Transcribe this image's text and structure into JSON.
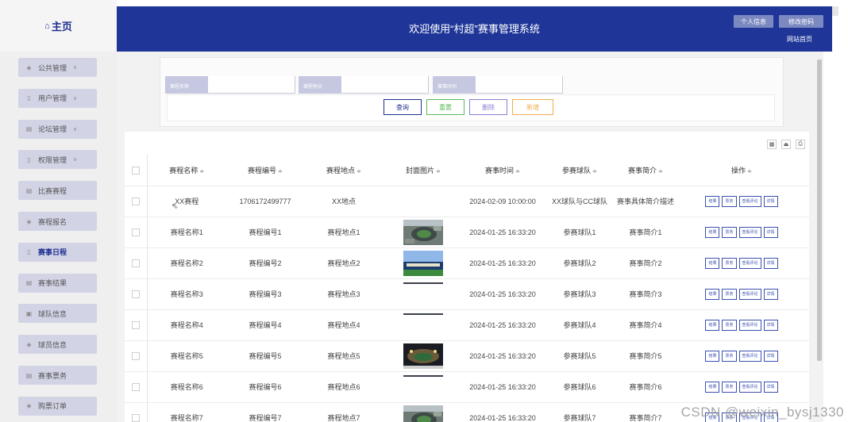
{
  "home": {
    "icon": "home-icon",
    "label": "主页"
  },
  "sidebar": {
    "items": [
      {
        "label": "公共管理",
        "icon": "layers-icon",
        "glyph": "◈",
        "chevron": true
      },
      {
        "label": "用户管理",
        "icon": "doc-icon",
        "glyph": "▯",
        "chevron": true
      },
      {
        "label": "论坛管理",
        "icon": "grid-icon",
        "glyph": "▤",
        "chevron": true
      },
      {
        "label": "权限管理",
        "icon": "doc-icon",
        "glyph": "▯",
        "chevron": true
      },
      {
        "label": "比赛赛程",
        "icon": "grid-icon",
        "glyph": "▤",
        "chevron": false
      },
      {
        "label": "赛程报名",
        "icon": "layers-icon",
        "glyph": "◈",
        "chevron": false
      },
      {
        "label": "赛事日程",
        "icon": "doc-icon",
        "glyph": "▯",
        "chevron": false,
        "active": true
      },
      {
        "label": "赛事结果",
        "icon": "grid-icon",
        "glyph": "▤",
        "chevron": false
      },
      {
        "label": "球队信息",
        "icon": "calendar-icon",
        "glyph": "▣",
        "chevron": false
      },
      {
        "label": "球员信息",
        "icon": "layers-icon",
        "glyph": "◈",
        "chevron": false
      },
      {
        "label": "赛事票务",
        "icon": "grid-icon",
        "glyph": "▤",
        "chevron": false
      },
      {
        "label": "购票订单",
        "icon": "layers-icon",
        "glyph": "◈",
        "chevron": false
      }
    ]
  },
  "header": {
    "title": "欢迎使用“村超”赛事管理系统",
    "profile_label": "个人信息",
    "password_label": "修改密码",
    "site_label": "网站首页"
  },
  "search": {
    "fields": [
      {
        "label": "赛程名称",
        "value": ""
      },
      {
        "label": "赛程地点",
        "value": ""
      },
      {
        "label": "赛事时间",
        "value": ""
      }
    ],
    "actions": {
      "query": "查询",
      "reset": "重置",
      "delete": "删除",
      "add": "新增"
    }
  },
  "table": {
    "tools": [
      {
        "icon": "columns-icon",
        "glyph": "▦"
      },
      {
        "icon": "export-icon",
        "glyph": "⏏"
      },
      {
        "icon": "print-icon",
        "glyph": "⎙"
      }
    ],
    "columns": [
      "赛程名称",
      "赛程编号",
      "赛程地点",
      "封面图片",
      "赛事时间",
      "参赛球队",
      "赛事简介",
      "操作"
    ],
    "sort_glyph": "≑",
    "row_actions": [
      "结果",
      "票务",
      "查看评论",
      "详情"
    ],
    "rows": [
      {
        "name": "XX赛程",
        "code": "1706172499777",
        "place": "XX地点",
        "image": "none",
        "time": "2024-02-09 10:00:00",
        "teams": "XX球队与CC球队",
        "intro": "赛事具体简介描述"
      },
      {
        "name": "赛程名称1",
        "code": "赛程编号1",
        "place": "赛程地点1",
        "image": "aerial-stadium",
        "time": "2024-01-25 16:33:20",
        "teams": "参赛球队1",
        "intro": "赛事简介1"
      },
      {
        "name": "赛程名称2",
        "code": "赛程编号2",
        "place": "赛程地点2",
        "image": "stadium-blue",
        "time": "2024-01-25 16:33:20",
        "teams": "参赛球队2",
        "intro": "赛事简介2"
      },
      {
        "name": "赛程名称3",
        "code": "赛程编号3",
        "place": "赛程地点3",
        "image": "thin-line",
        "time": "2024-01-25 16:33:20",
        "teams": "参赛球队3",
        "intro": "赛事简介3"
      },
      {
        "name": "赛程名称4",
        "code": "赛程编号4",
        "place": "赛程地点4",
        "image": "thin-line",
        "time": "2024-01-25 16:33:20",
        "teams": "参赛球队4",
        "intro": "赛事简介4"
      },
      {
        "name": "赛程名称5",
        "code": "赛程编号5",
        "place": "赛程地点5",
        "image": "night-stadium",
        "time": "2024-01-25 16:33:20",
        "teams": "参赛球队5",
        "intro": "赛事简介5"
      },
      {
        "name": "赛程名称6",
        "code": "赛程编号6",
        "place": "赛程地点6",
        "image": "thin-line",
        "time": "2024-01-25 16:33:20",
        "teams": "参赛球队6",
        "intro": "赛事简介6"
      },
      {
        "name": "赛程名称7",
        "code": "赛程编号7",
        "place": "赛程地点7",
        "image": "aerial-stadium",
        "time": "2024-01-25 16:33:20",
        "teams": "参赛球队7",
        "intro": "赛事简介7"
      }
    ]
  },
  "watermark": "CSDN @weixin_bysj1330",
  "colors": {
    "header_bg": "#1f3698",
    "sidebar_item": "#d2d4e6",
    "accent": "#1f2f8f",
    "reset": "#5cb85c",
    "delete": "#8a7fd6",
    "add": "#f0ad4e"
  }
}
